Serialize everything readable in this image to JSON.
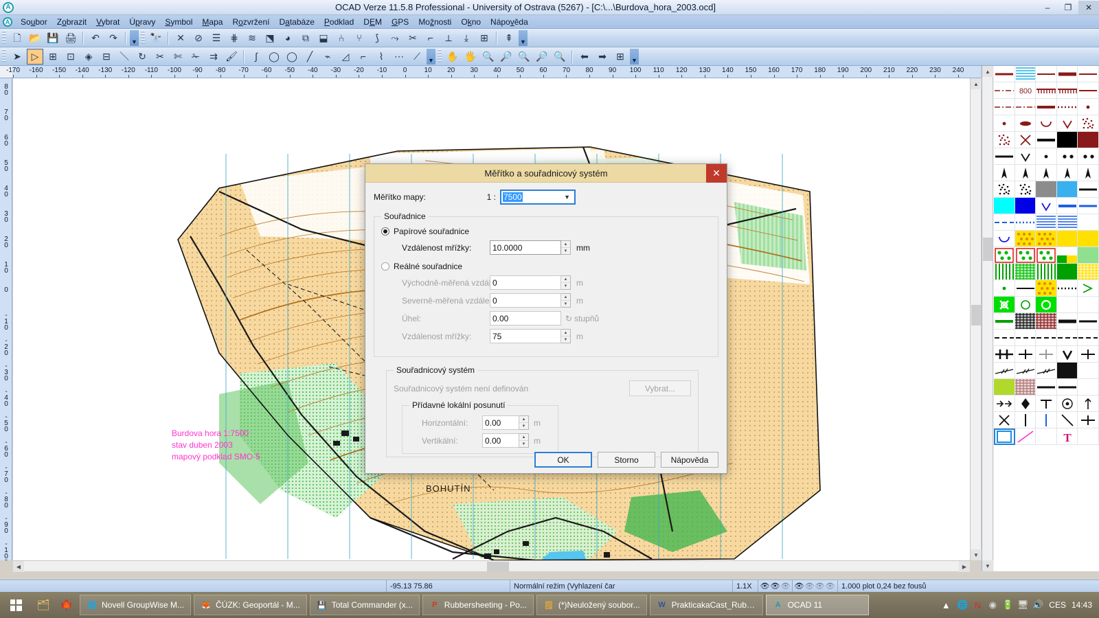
{
  "window": {
    "title": "OCAD Verze 11.5.8  Professional - University of Ostrava (5267) - [C:\\...\\Burdova_hora_2003.ocd]",
    "app_icon": "A",
    "minimize": "–",
    "maximize": "❐",
    "close": "✕"
  },
  "menubar": {
    "items": [
      {
        "label": "Soubor",
        "accel_index": 2
      },
      {
        "label": "Zobrazit",
        "accel_index": 1
      },
      {
        "label": "Vybrat",
        "accel_index": 0
      },
      {
        "label": "Úpravy",
        "accel_index": 1
      },
      {
        "label": "Symbol",
        "accel_index": 0
      },
      {
        "label": "Mapa",
        "accel_index": 0
      },
      {
        "label": "Rozvržení",
        "accel_index": 1
      },
      {
        "label": "Databáze",
        "accel_index": 1
      },
      {
        "label": "Podklad",
        "accel_index": 0
      },
      {
        "label": "DEM",
        "accel_index": 1
      },
      {
        "label": "GPS",
        "accel_index": 0
      },
      {
        "label": "Možnosti",
        "accel_index": 2
      },
      {
        "label": "Okno",
        "accel_index": 1
      },
      {
        "label": "Nápověda",
        "accel_index": 4
      }
    ]
  },
  "toolbar_standard": {
    "buttons": [
      {
        "name": "new-file-icon",
        "glyph": "🗋"
      },
      {
        "name": "open-file-icon",
        "glyph": "📂"
      },
      {
        "name": "save-file-icon",
        "glyph": "💾"
      },
      {
        "name": "print-icon",
        "glyph": "🖨"
      },
      {
        "name": "undo-icon",
        "glyph": "↶"
      },
      {
        "name": "redo-icon",
        "glyph": "↷"
      },
      {
        "name": "find-icon",
        "glyph": "🔭"
      },
      {
        "name": "delete-object-icon",
        "glyph": "✕"
      },
      {
        "name": "check-object-icon",
        "glyph": "⊘"
      },
      {
        "name": "align-icon",
        "glyph": "☰"
      },
      {
        "name": "fence-icon",
        "glyph": "⋕"
      },
      {
        "name": "layers-icon",
        "glyph": "≋"
      },
      {
        "name": "move-to-front-icon",
        "glyph": "⬔"
      },
      {
        "name": "fill-icon",
        "glyph": "◕"
      },
      {
        "name": "merge-icon",
        "glyph": "⧉"
      },
      {
        "name": "cut-hole-icon",
        "glyph": "⬓"
      },
      {
        "name": "parallel-icon",
        "glyph": "⑃"
      },
      {
        "name": "duplicate-icon",
        "glyph": "⑂"
      },
      {
        "name": "rotate-obj-icon",
        "glyph": "⟆"
      },
      {
        "name": "reshape-icon",
        "glyph": "⤳"
      },
      {
        "name": "cut-segment-icon",
        "glyph": "✂"
      },
      {
        "name": "snap-icon",
        "glyph": "⌐"
      },
      {
        "name": "measure-icon",
        "glyph": "⟂"
      },
      {
        "name": "to-baseline-icon",
        "glyph": "⤓"
      },
      {
        "name": "table-icon",
        "glyph": "⊞"
      },
      {
        "name": "text-align-icon",
        "glyph": "⇞"
      }
    ],
    "overflow": "▼"
  },
  "toolbar_draw": {
    "buttons": [
      {
        "name": "select-arrow-icon",
        "glyph": "➤"
      },
      {
        "name": "edit-point-icon",
        "glyph": "▷",
        "active": true
      },
      {
        "name": "add-point-icon",
        "glyph": "⊞"
      },
      {
        "name": "insert-corner-icon",
        "glyph": "⊡"
      },
      {
        "name": "insert-bezier-icon",
        "glyph": "◈"
      },
      {
        "name": "delete-point-icon",
        "glyph": "⊟"
      },
      {
        "name": "move-point-icon",
        "glyph": "＼"
      },
      {
        "name": "rotate-icon",
        "glyph": "↻"
      },
      {
        "name": "cut-icon",
        "glyph": "✂"
      },
      {
        "name": "cut-area-icon",
        "glyph": "✄"
      },
      {
        "name": "cut-hole2-icon",
        "glyph": "✁"
      },
      {
        "name": "measure-line-icon",
        "glyph": "⇉"
      },
      {
        "name": "fill-brush-icon",
        "glyph": "🖌"
      },
      {
        "name": "curve-tool-icon",
        "glyph": "∫"
      },
      {
        "name": "ellipse-tool-icon",
        "glyph": "◯"
      },
      {
        "name": "circle-tool-icon",
        "glyph": "◯"
      },
      {
        "name": "line-tool-icon",
        "glyph": "╱"
      },
      {
        "name": "polyline-tool-icon",
        "glyph": "⌁"
      },
      {
        "name": "bezier-tool-icon",
        "glyph": "◿"
      },
      {
        "name": "rect-tool-icon",
        "glyph": "⌐"
      },
      {
        "name": "freehand-icon",
        "glyph": "⌇"
      },
      {
        "name": "numeric-icon",
        "glyph": "⋯"
      },
      {
        "name": "straight-line-icon",
        "glyph": "⟋"
      }
    ],
    "zoom_buttons": [
      {
        "name": "pan-hand-icon",
        "glyph": "✋"
      },
      {
        "name": "pan-page-icon",
        "glyph": "🖐"
      },
      {
        "name": "zoom-in-icon",
        "glyph": "🔍"
      },
      {
        "name": "zoom-in-window-icon",
        "glyph": "🔎"
      },
      {
        "name": "zoom-out-icon",
        "glyph": "🔍"
      },
      {
        "name": "zoom-out-window-icon",
        "glyph": "🔎"
      },
      {
        "name": "zoom-all-icon",
        "glyph": "🔍"
      },
      {
        "name": "previous-view-icon",
        "glyph": "⬅"
      },
      {
        "name": "next-view-icon",
        "glyph": "➡"
      },
      {
        "name": "grid-icon",
        "glyph": "⊞"
      }
    ],
    "overflow": "▼"
  },
  "rulers": {
    "horizontal_ticks": [
      -170,
      -160,
      -150,
      -140,
      -130,
      -120,
      -110,
      -100,
      -90,
      -80,
      -70,
      -60,
      -50,
      -40,
      -30,
      -20,
      -10,
      0,
      10,
      20,
      30,
      40,
      50,
      60,
      70,
      80,
      90,
      100,
      110,
      120,
      130,
      140,
      150,
      160,
      170,
      180,
      190,
      200,
      210,
      220,
      230,
      240
    ],
    "vertical_ticks": [
      80,
      70,
      60,
      50,
      40,
      30,
      20,
      10,
      0,
      -10,
      -20,
      -30,
      -40,
      -50,
      -60,
      -70,
      -80,
      -90,
      -100
    ]
  },
  "map": {
    "annotation": "Burdova hora 1:7500\nstav duben 2003\nmapový podklad SMO-5",
    "town_label": "BOHUTÍN",
    "annotation_color": "#ff33cc"
  },
  "dialog": {
    "title": "Měřítko a souřadnicový systém",
    "close_glyph": "✕",
    "scale_label": "Měřítko mapy:",
    "scale_prefix": "1 :",
    "scale_value": "7500",
    "coords_group": "Souřadnice",
    "paper_coords_label": "Papírové souřadnice",
    "paper_grid_label": "Vzdálenost mřížky:",
    "paper_grid_value": "10.0000",
    "paper_grid_unit": "mm",
    "real_coords_label": "Reálné souřadnice",
    "east_label": "Východně-měřená vzdálen",
    "east_value": "0",
    "east_unit": "m",
    "north_label": "Severně-měřená vzdálenos",
    "north_value": "0",
    "north_unit": "m",
    "angle_label": "Úhel:",
    "angle_value": "0.00",
    "angle_unit": "stupňů",
    "angle_icon": "↻",
    "real_grid_label": "Vzdálenost mřížky:",
    "real_grid_value": "75",
    "real_grid_unit": "m",
    "crs_group": "Souřadnicový systém",
    "crs_status": "Souřadnicový systém není definován",
    "crs_select_button": "Vybrat...",
    "offset_group": "Přídavné lokální posunutí",
    "horizontal_label": "Horizontální:",
    "horizontal_value": "0.00",
    "horizontal_unit": "m",
    "vertical_label": "Vertikální:",
    "vertical_value": "0.00",
    "vertical_unit": "m",
    "ok_button": "OK",
    "cancel_button": "Storno",
    "help_button": "Nápověda",
    "spin_up": "▲",
    "spin_down": "▼"
  },
  "statusbar": {
    "coordinates": "-95.13  75.86",
    "mode": "Normální režim (Vyhlazení čar",
    "zoom": "1.1X",
    "scale_info": "1.000 plot 0,24 bez fousů",
    "eye_icons": [
      "👁",
      "👁",
      "👁",
      "👁",
      "👁",
      "👁",
      "👁"
    ]
  },
  "taskbar": {
    "start_glyph": "⊞",
    "quick_launch": [
      {
        "name": "explorer-icon",
        "glyph": "🗂",
        "color": "#e8c76a"
      },
      {
        "name": "maple-icon",
        "glyph": "🍁",
        "color": "#cc2b2b"
      }
    ],
    "items": [
      {
        "label": "Novell GroupWise M...",
        "icon": "🌐",
        "color": "#8fa8bd",
        "active": false
      },
      {
        "label": "ČÚZK: Geoportál - M...",
        "icon": "🦊",
        "color": "#e8791a",
        "active": false
      },
      {
        "label": "Total Commander (x...",
        "icon": "💾",
        "color": "#3a6fbf",
        "active": false
      },
      {
        "label": "Rubbersheeting - Po...",
        "icon": "P",
        "color": "#cc3b22",
        "active": false
      },
      {
        "label": "(*)Neuložený soubor...",
        "icon": "🗒",
        "color": "#d9a441",
        "active": false
      },
      {
        "label": "PrakticakaCast_Rubbe...",
        "icon": "W",
        "color": "#2a5699",
        "active": false
      },
      {
        "label": "OCAD 11",
        "icon": "A",
        "color": "#1c9cb0",
        "active": true
      }
    ],
    "tray": {
      "chevron": "▲",
      "icons": [
        {
          "name": "network-icon",
          "glyph": "🌐",
          "color": "#3d8fd0"
        },
        {
          "name": "norton-icon",
          "glyph": "N",
          "color": "#d92b2b"
        },
        {
          "name": "disc-icon",
          "glyph": "◉",
          "color": "#d8d8d8"
        },
        {
          "name": "battery-icon",
          "glyph": "🔋",
          "color": "#dadada"
        },
        {
          "name": "display-icon",
          "glyph": "🖥",
          "color": "#dadada"
        },
        {
          "name": "volume-icon",
          "glyph": "🔊",
          "color": "#ffffff"
        }
      ],
      "language": "CES",
      "clock": "14:43"
    }
  },
  "symbol_panel": {
    "rows": [
      [
        {
          "t": "line",
          "c": "#8a1a1a",
          "w": 3
        },
        {
          "t": "hatch",
          "c": "#19b0e8"
        },
        {
          "t": "line",
          "c": "#8a1a1a",
          "w": 2
        },
        {
          "t": "line",
          "c": "#8a1a1a",
          "w": 5
        },
        {
          "t": "line",
          "c": "#8a1a1a",
          "w": 2
        }
      ],
      [
        {
          "t": "dashdot",
          "c": "#8a1a1a"
        },
        {
          "t": "text",
          "v": "800",
          "c": "#8a1a1a"
        },
        {
          "t": "ticks",
          "c": "#8a1a1a"
        },
        {
          "t": "ticks",
          "c": "#8a1a1a"
        },
        {
          "t": "line",
          "c": "#8a1a1a",
          "w": 2
        }
      ],
      [
        {
          "t": "dashdot",
          "c": "#8a1a1a"
        },
        {
          "t": "dashdot",
          "c": "#8a1a1a"
        },
        {
          "t": "line",
          "c": "#8a1a1a",
          "w": 4
        },
        {
          "t": "dotted",
          "c": "#8a1a1a"
        },
        {
          "t": "dot",
          "c": "#8a1a1a"
        }
      ],
      [
        {
          "t": "dot",
          "c": "#8a1a1a"
        },
        {
          "t": "blob",
          "c": "#8a1a1a"
        },
        {
          "t": "arc",
          "c": "#8a1a1a"
        },
        {
          "t": "vee",
          "c": "#8a1a1a"
        },
        {
          "t": "stipple",
          "c": "#8a1a1a"
        }
      ],
      [
        {
          "t": "stipple",
          "c": "#8a1a1a"
        },
        {
          "t": "cross",
          "c": "#8a1a1a"
        },
        {
          "t": "line",
          "c": "#111",
          "w": 4
        },
        {
          "t": "fill",
          "c": "#000000"
        },
        {
          "t": "fill",
          "c": "#8a1a1a"
        }
      ],
      [
        {
          "t": "line",
          "c": "#111",
          "w": 3
        },
        {
          "t": "vee",
          "c": "#111"
        },
        {
          "t": "dot",
          "c": "#111"
        },
        {
          "t": "dot2",
          "c": "#111"
        },
        {
          "t": "dot2",
          "c": "#111"
        }
      ],
      [
        {
          "t": "tri",
          "c": "#111"
        },
        {
          "t": "tri",
          "c": "#111"
        },
        {
          "t": "tri",
          "c": "#111"
        },
        {
          "t": "tri",
          "c": "#111"
        },
        {
          "t": "tri",
          "c": "#111"
        }
      ],
      [
        {
          "t": "stipple",
          "c": "#111"
        },
        {
          "t": "stipple",
          "c": "#111"
        },
        {
          "t": "fill",
          "c": "#8c8c8c"
        },
        {
          "t": "fill",
          "c": "#39b0ef"
        },
        {
          "t": "line",
          "c": "#111",
          "w": 3
        }
      ],
      [
        {
          "t": "fill",
          "c": "#00ffff"
        },
        {
          "t": "fill",
          "c": "#0000e6"
        },
        {
          "t": "vee",
          "c": "#1a1ae6"
        },
        {
          "t": "line",
          "c": "#1a5fe6",
          "w": 4
        },
        {
          "t": "line",
          "c": "#1a5fe6",
          "w": 3
        }
      ],
      [
        {
          "t": "dash",
          "c": "#1a5fe6"
        },
        {
          "t": "dotted",
          "c": "#1a5fe6"
        },
        {
          "t": "hatch",
          "c": "#1a5fe6"
        },
        {
          "t": "hatch",
          "c": "#1a5fe6"
        },
        {
          "t": "blank"
        }
      ],
      [
        {
          "t": "arc",
          "c": "#1a1ae6"
        },
        {
          "t": "dotfill",
          "c": "#ffe000"
        },
        {
          "t": "dotfill",
          "c": "#ffe000"
        },
        {
          "t": "fill",
          "c": "#ffe000"
        },
        {
          "t": "fill",
          "c": "#ffe000"
        }
      ],
      [
        {
          "t": "greendot",
          "c": "#00a000"
        },
        {
          "t": "greendot",
          "c": "#00a000"
        },
        {
          "t": "greendot",
          "c": "#00a000"
        },
        {
          "t": "half",
          "c": "#ffe000"
        },
        {
          "t": "fill",
          "c": "#8fe08f"
        }
      ],
      [
        {
          "t": "vstripe",
          "c": "#00a000"
        },
        {
          "t": "check",
          "c": "#00c000"
        },
        {
          "t": "vstripe",
          "c": "#00a000"
        },
        {
          "t": "fill",
          "c": "#00a000"
        },
        {
          "t": "check",
          "c": "#ffe000"
        }
      ],
      [
        {
          "t": "dot",
          "c": "#00a000"
        },
        {
          "t": "line",
          "c": "#111",
          "w": 2
        },
        {
          "t": "dotfill",
          "c": "#ffe000"
        },
        {
          "t": "dotted",
          "c": "#111"
        },
        {
          "t": "arrow",
          "c": "#00a000"
        }
      ],
      [
        {
          "t": "greenx",
          "c": "#00e000"
        },
        {
          "t": "ring",
          "c": "#00a000"
        },
        {
          "t": "greenring",
          "c": "#00e000"
        },
        {
          "t": "blank"
        },
        {
          "t": "blank"
        }
      ],
      [
        {
          "t": "line",
          "c": "#00a000",
          "w": 4
        },
        {
          "t": "check",
          "c": "#111"
        },
        {
          "t": "check",
          "c": "#8a1a1a"
        },
        {
          "t": "line",
          "c": "#111",
          "w": 5
        },
        {
          "t": "line",
          "c": "#111",
          "w": 3
        }
      ],
      [
        {
          "t": "dash",
          "c": "#111"
        },
        {
          "t": "dash",
          "c": "#111"
        },
        {
          "t": "dash",
          "c": "#111"
        },
        {
          "t": "dash",
          "c": "#111"
        },
        {
          "t": "dash",
          "c": "#111"
        }
      ],
      [
        {
          "t": "plusplus",
          "c": "#111"
        },
        {
          "t": "plus",
          "c": "#111"
        },
        {
          "t": "plus",
          "c": "#9a9a9a"
        },
        {
          "t": "veeblk",
          "c": "#111"
        },
        {
          "t": "plus",
          "c": "#111"
        }
      ],
      [
        {
          "t": "tickline",
          "c": "#111"
        },
        {
          "t": "tickline",
          "c": "#111"
        },
        {
          "t": "tickline",
          "c": "#111"
        },
        {
          "t": "fill",
          "c": "#111"
        },
        {
          "t": "blank"
        }
      ],
      [
        {
          "t": "fill",
          "c": "#b0d92b"
        },
        {
          "t": "check",
          "c": "#b07070"
        },
        {
          "t": "line",
          "c": "#111",
          "w": 3
        },
        {
          "t": "line",
          "c": "#111",
          "w": 3
        },
        {
          "t": "blank"
        }
      ],
      [
        {
          "t": "arrow2",
          "c": "#111"
        },
        {
          "t": "diamond",
          "c": "#111"
        },
        {
          "t": "tee",
          "c": "#111"
        },
        {
          "t": "target",
          "c": "#111"
        },
        {
          "t": "uparrow",
          "c": "#111"
        }
      ],
      [
        {
          "t": "cross",
          "c": "#111"
        },
        {
          "t": "vbar",
          "c": "#111"
        },
        {
          "t": "vbar",
          "c": "#1a5fe6"
        },
        {
          "t": "slash",
          "c": "#111"
        },
        {
          "t": "plus",
          "c": "#111"
        }
      ],
      [
        {
          "t": "selrect",
          "c": "#1a8fe6",
          "sel": true
        },
        {
          "t": "pink",
          "c": "#ff33cc"
        },
        {
          "t": "blank"
        },
        {
          "t": "tmark",
          "c": "#cc1177"
        },
        {
          "t": "blank"
        }
      ]
    ]
  }
}
